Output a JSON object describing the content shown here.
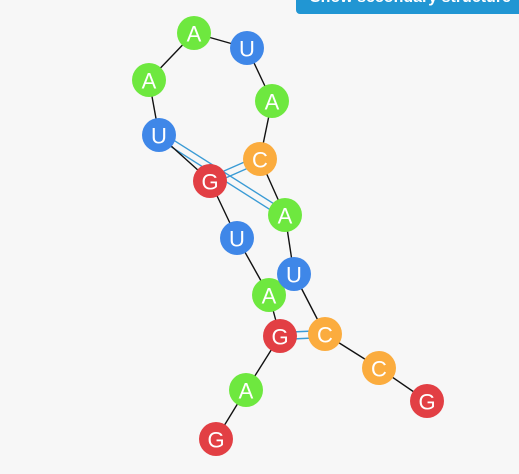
{
  "toolbar": {
    "toggle_label": "Show secondary structure"
  },
  "colors": {
    "A": "#6ee83f",
    "U": "#3f87e8",
    "G": "#e23f44",
    "C": "#fbac3e"
  },
  "sequence": [
    "G",
    "A",
    "G",
    "A",
    "U",
    "G",
    "U",
    "A",
    "A",
    "U",
    "A",
    "C",
    "A",
    "U",
    "C",
    "C",
    "G"
  ],
  "base_pairs": [
    [
      5,
      11
    ],
    [
      6,
      12
    ],
    [
      2,
      14
    ]
  ]
}
